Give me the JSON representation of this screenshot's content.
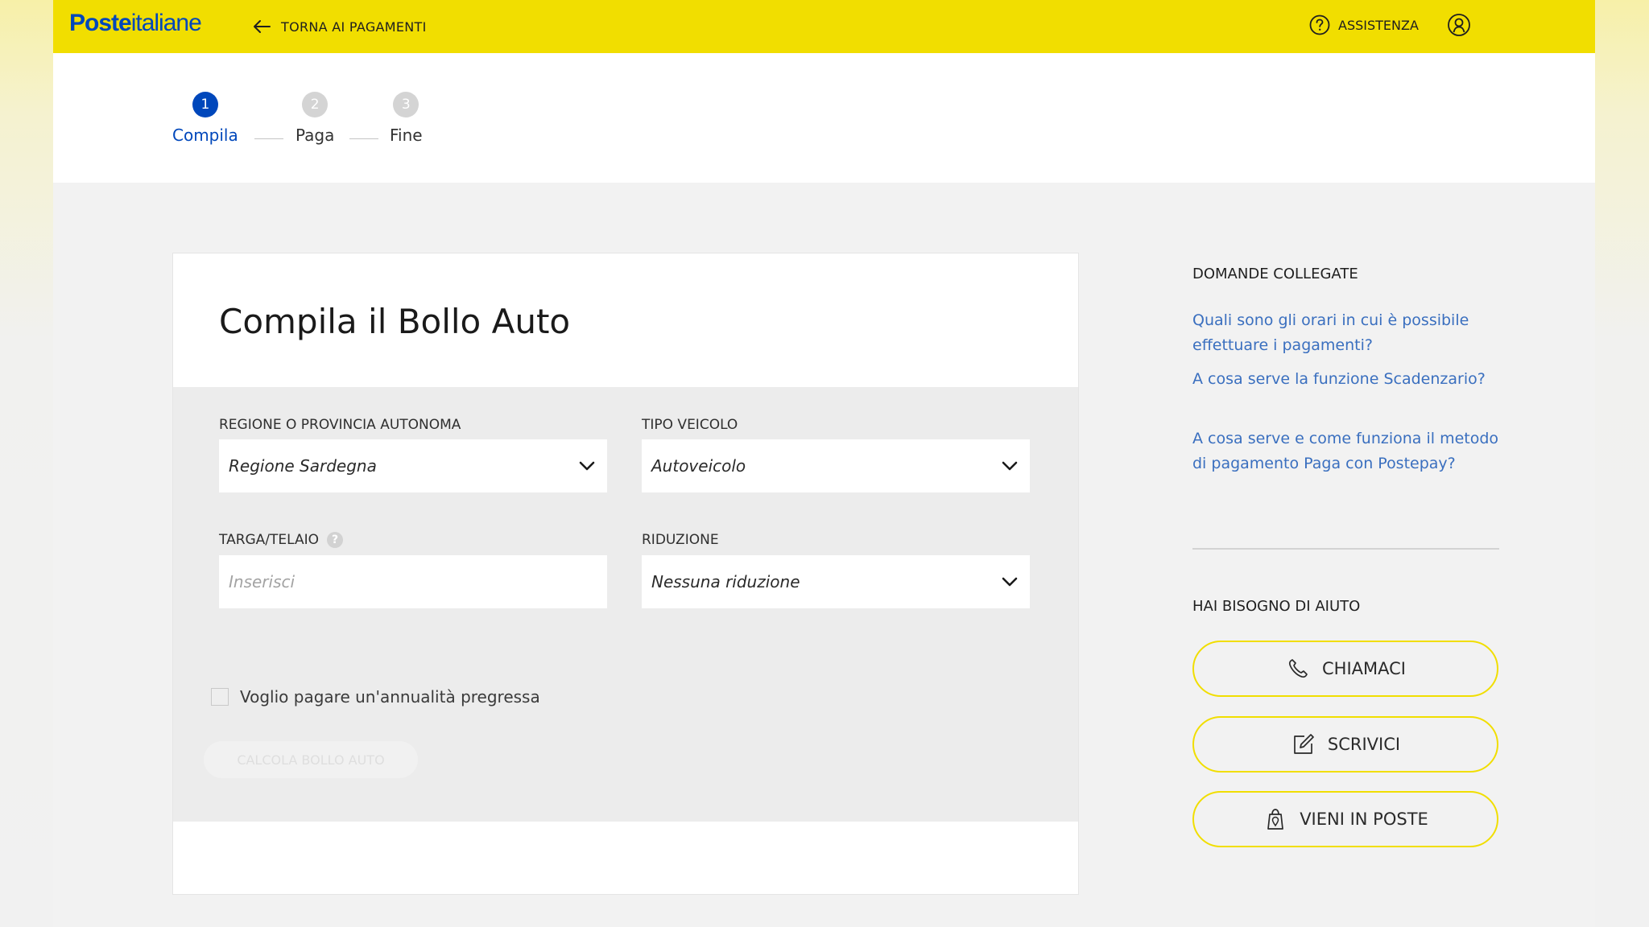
{
  "header": {
    "logo_bold": "Poste",
    "logo_thin": "italiane",
    "back_label": "TORNA AI PAGAMENTI",
    "assist_label": "ASSISTENZA"
  },
  "steps": [
    {
      "number": "1",
      "label": "Compila",
      "active": true
    },
    {
      "number": "2",
      "label": "Paga",
      "active": false
    },
    {
      "number": "3",
      "label": "Fine",
      "active": false
    }
  ],
  "form": {
    "title": "Compila il Bollo Auto",
    "region": {
      "label": "REGIONE O PROVINCIA AUTONOMA",
      "value": "Regione Sardegna"
    },
    "vehicle_type": {
      "label": "TIPO VEICOLO",
      "value": "Autoveicolo"
    },
    "plate": {
      "label": "TARGA/TELAIO",
      "placeholder": "Inserisci",
      "help": "?"
    },
    "reduction": {
      "label": "RIDUZIONE",
      "value": "Nessuna riduzione"
    },
    "past_year_checkbox": {
      "label": "Voglio pagare un'annualità pregressa",
      "checked": false
    },
    "calculate_button": "CALCOLA BOLLO AUTO"
  },
  "sidebar": {
    "related_heading": "DOMANDE COLLEGATE",
    "related_links": [
      "Quali sono gli orari in cui è possibile effettuare i pagamenti?",
      "A cosa serve la funzione Scadenzario?",
      "A cosa serve e come funziona il metodo di pagamento Paga con Postepay?"
    ],
    "help_heading": "HAI BISOGNO DI AIUTO",
    "help_buttons": [
      {
        "label": "CHIAMACI",
        "icon": "phone-icon"
      },
      {
        "label": "SCRIVICI",
        "icon": "edit-icon"
      },
      {
        "label": "VIENI IN POSTE",
        "icon": "location-bag-icon"
      }
    ]
  },
  "colors": {
    "brand_yellow": "#f1de00",
    "brand_blue": "#0047bb",
    "link_blue": "#3a6fbf"
  }
}
